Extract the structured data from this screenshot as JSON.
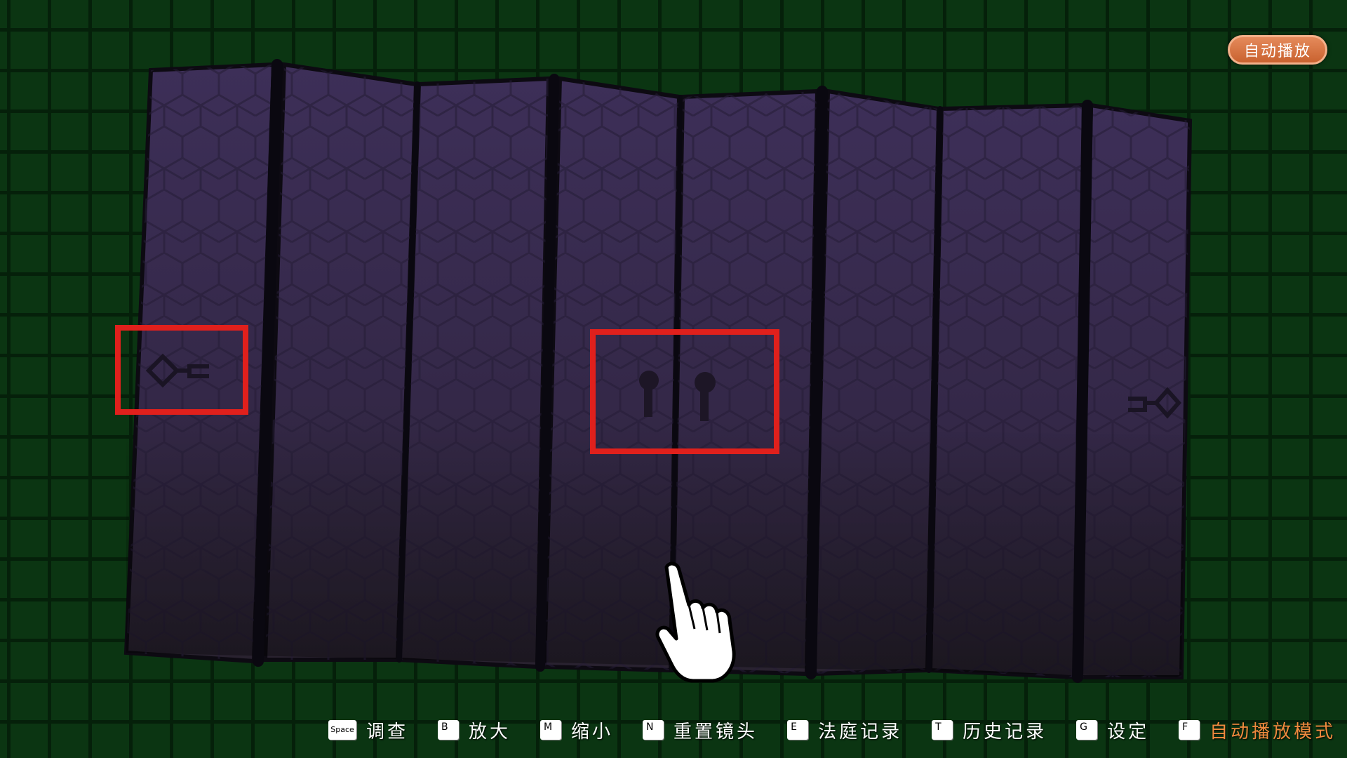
{
  "top_button": {
    "label": "自动播放"
  },
  "controls": [
    {
      "key": "Space",
      "label": "调查"
    },
    {
      "key": "B",
      "label": "放大"
    },
    {
      "key": "M",
      "label": "缩小"
    },
    {
      "key": "N",
      "label": "重置镜头"
    },
    {
      "key": "E",
      "label": "法庭记录"
    },
    {
      "key": "T",
      "label": "历史记录"
    },
    {
      "key": "G",
      "label": "设定"
    },
    {
      "key": "F",
      "label": "自动播放模式"
    }
  ],
  "colors": {
    "background": "#0b3512",
    "grid_line": "#05200a",
    "panel": "#3a2d54",
    "panel_bottom": "#2b2236",
    "highlight_box": "#e0201c",
    "active_label": "#f08a3e",
    "button": "#d5703f"
  },
  "icons": {
    "left_symbol": "key-shaped-mark",
    "center_symbol": "pair-of-keyholes",
    "right_symbol": "key-shaped-mark-mirrored",
    "cursor": "pointing-hand-cursor"
  }
}
